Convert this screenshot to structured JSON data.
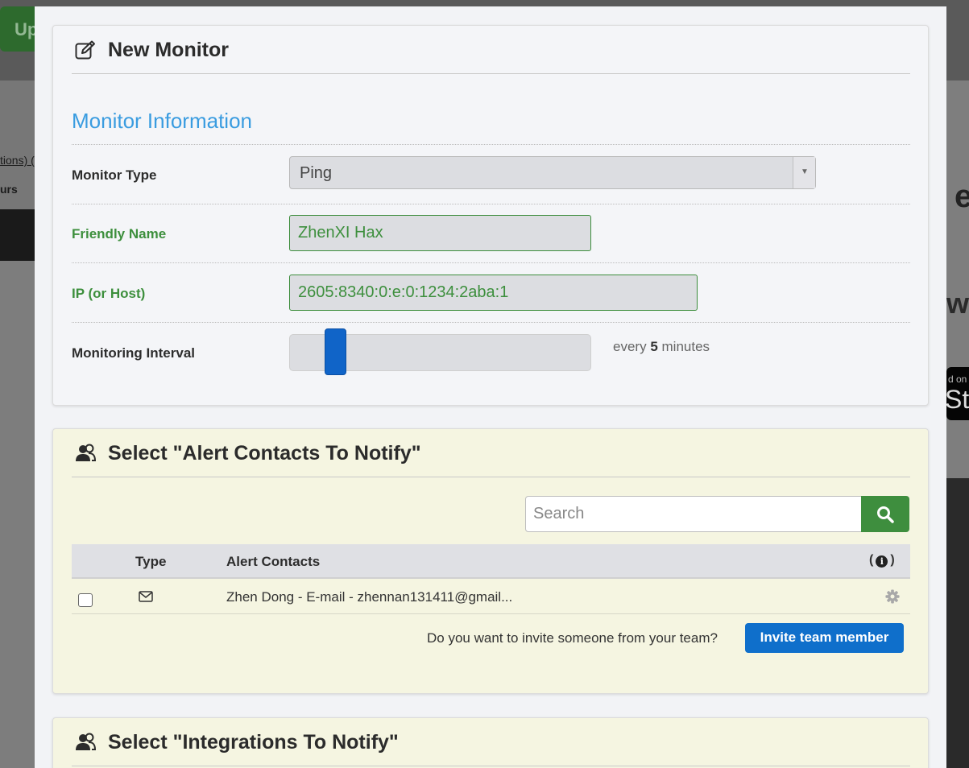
{
  "background": {
    "upgrade_button_label": "Up",
    "left_link_fragment": "tions) (",
    "left_text_fragment": "urs",
    "right_letter_1": "e",
    "right_letter_2": "w",
    "store_text_small": "d on",
    "store_text_large": "St"
  },
  "new_monitor": {
    "title": "New Monitor",
    "section_title": "Monitor Information",
    "monitor_type_label": "Monitor Type",
    "monitor_type_value": "Ping",
    "friendly_name_label": "Friendly Name",
    "friendly_name_value": "ZhenXI Hax",
    "ip_label": "IP (or Host)",
    "ip_value": "2605:8340:0:e:0:1234:2aba:1",
    "interval_label": "Monitoring Interval",
    "interval_prefix": "every",
    "interval_value": "5",
    "interval_suffix": "minutes"
  },
  "alert_contacts": {
    "title": "Select \"Alert Contacts To Notify\"",
    "search_placeholder": "Search",
    "columns": {
      "type": "Type",
      "contacts": "Alert Contacts",
      "info_open": "(",
      "info_close": ")"
    },
    "rows": [
      {
        "type_icon": "envelope-icon",
        "text": "Zhen Dong - E-mail - zhennan131411@gmail..."
      }
    ],
    "invite_question": "Do you want to invite someone from your team?",
    "invite_button": "Invite team member"
  },
  "integrations": {
    "title": "Select \"Integrations To Notify\""
  },
  "colors": {
    "accent_blue": "#3a9ce0",
    "valid_green": "#3d8f3d",
    "primary_button": "#0f6fcb",
    "search_button": "#3e8e3e"
  }
}
